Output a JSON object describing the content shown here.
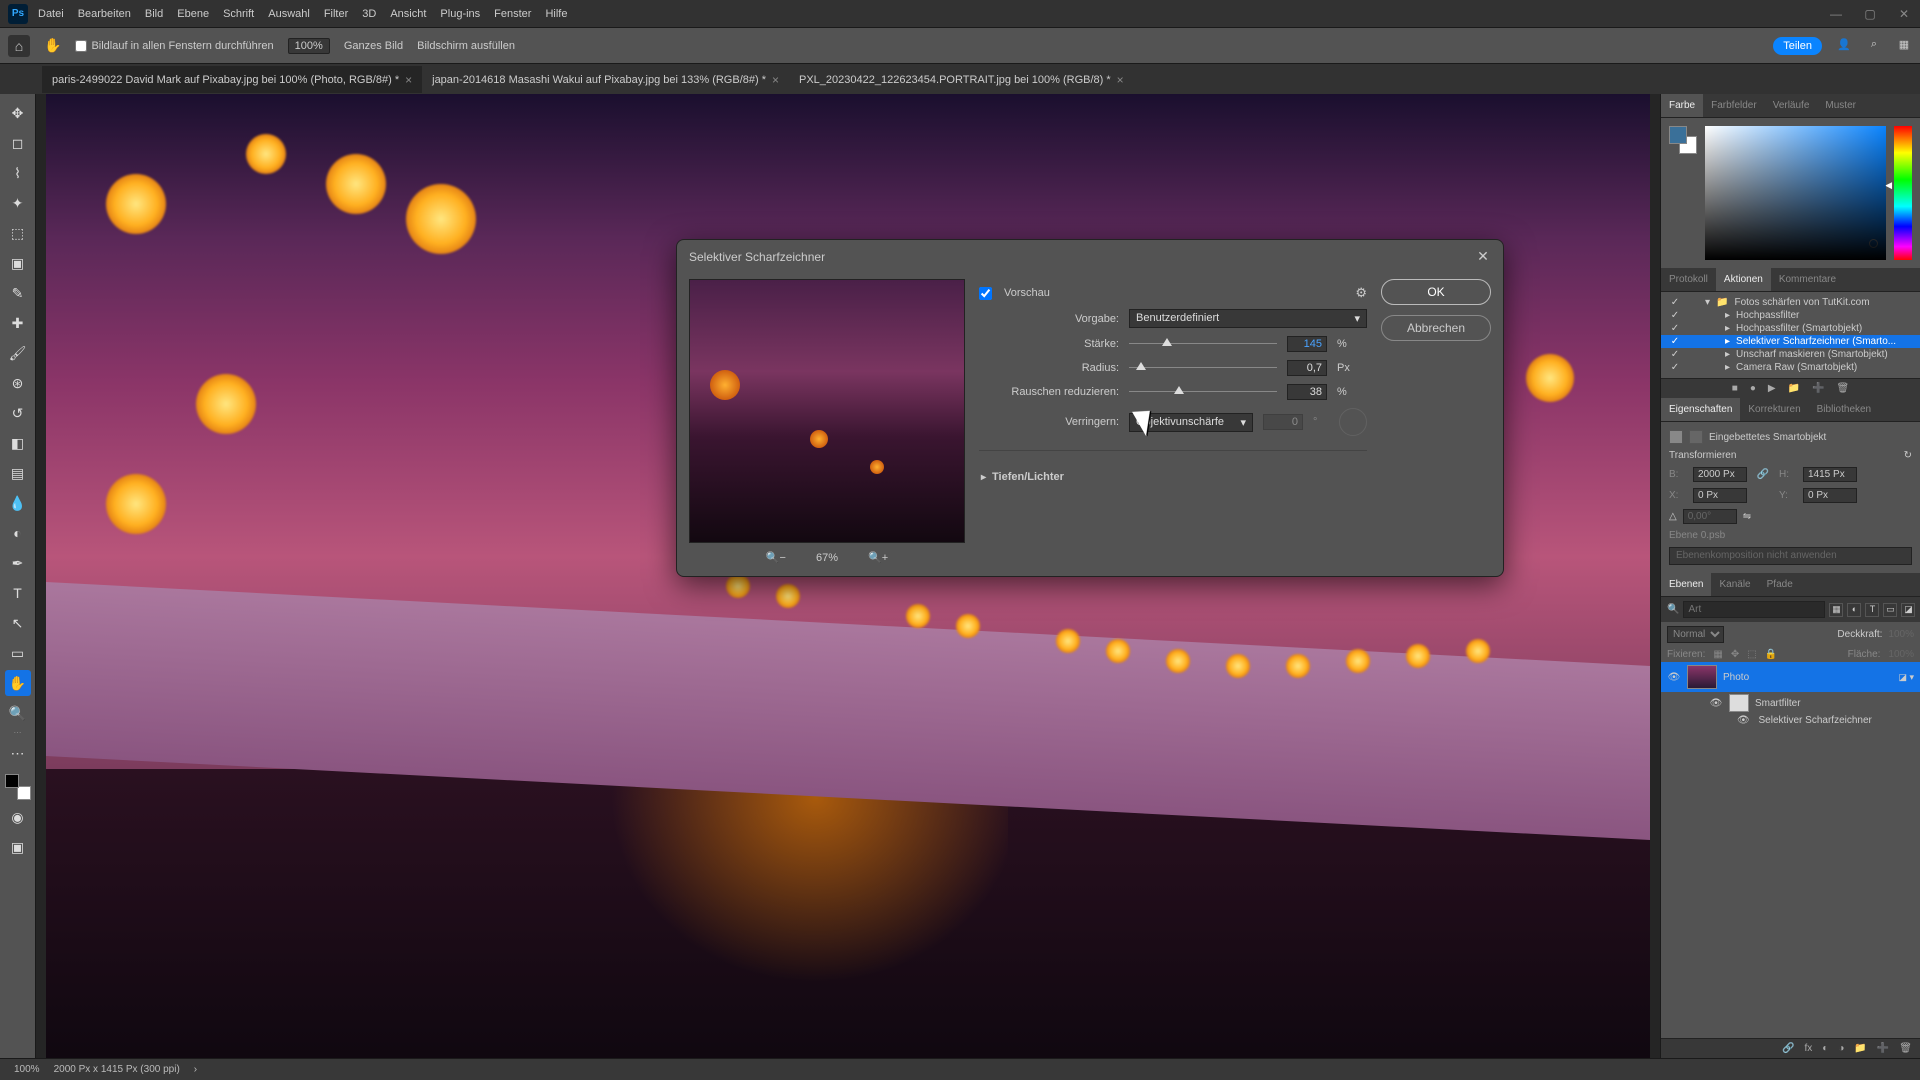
{
  "menu": {
    "items": [
      "Datei",
      "Bearbeiten",
      "Bild",
      "Ebene",
      "Schrift",
      "Auswahl",
      "Filter",
      "3D",
      "Ansicht",
      "Plug-ins",
      "Fenster",
      "Hilfe"
    ]
  },
  "options": {
    "scroll_all": "Bildlauf in allen Fenstern durchführen",
    "zoom_val": "100%",
    "fit": "Ganzes Bild",
    "fill": "Bildschirm ausfüllen",
    "share": "Teilen"
  },
  "tabs": [
    {
      "label": "paris-2499022  David Mark auf Pixabay.jpg bei 100% (Photo, RGB/8#) *",
      "active": true
    },
    {
      "label": "japan-2014618 Masashi Wakui auf Pixabay.jpg bei 133% (RGB/8#) *",
      "active": false
    },
    {
      "label": "PXL_20230422_122623454.PORTRAIT.jpg bei 100% (RGB/8) *",
      "active": false
    }
  ],
  "dialog": {
    "title": "Selektiver Scharfzeichner",
    "preview_label": "Vorschau",
    "preset_label": "Vorgabe:",
    "preset_value": "Benutzerdefiniert",
    "strength_label": "Stärke:",
    "strength_value": "145",
    "strength_unit": "%",
    "radius_label": "Radius:",
    "radius_value": "0,7",
    "radius_unit": "Px",
    "noise_label": "Rauschen reduzieren:",
    "noise_value": "38",
    "noise_unit": "%",
    "remove_label": "Verringern:",
    "remove_value": "Objektivunschärfe",
    "remove_amount": "0",
    "remove_unit": "°",
    "section": "Tiefen/Lichter",
    "zoom": "67%",
    "ok": "OK",
    "cancel": "Abbrechen"
  },
  "right": {
    "color_tabs": [
      "Farbe",
      "Farbfelder",
      "Verläufe",
      "Muster"
    ],
    "action_tabs": [
      "Protokoll",
      "Aktionen",
      "Kommentare"
    ],
    "actions_folder": "Fotos schärfen von TutKit.com",
    "actions": [
      {
        "name": "Hochpassfilter",
        "sel": false
      },
      {
        "name": "Hochpassfilter (Smartobjekt)",
        "sel": false
      },
      {
        "name": "Selektiver Scharfzeichner (Smarto...",
        "sel": true
      },
      {
        "name": "Unscharf maskieren (Smartobjekt)",
        "sel": false
      },
      {
        "name": "Camera Raw (Smartobjekt)",
        "sel": false
      }
    ],
    "props_tabs": [
      "Eigenschaften",
      "Korrekturen",
      "Bibliotheken"
    ],
    "props": {
      "type": "Eingebettetes Smartobjekt",
      "transform_head": "Transformieren",
      "w_lbl": "B:",
      "w": "2000 Px",
      "h_lbl": "H:",
      "h": "1415 Px",
      "x_lbl": "X:",
      "x": "0 Px",
      "y_lbl": "Y:",
      "y": "0 Px",
      "angle": "0,00°",
      "layer_name": "Ebene 0.psb",
      "comp": "Ebenenkomposition nicht anwenden"
    },
    "layer_tabs": [
      "Ebenen",
      "Kanäle",
      "Pfade"
    ],
    "layers": {
      "search_ph": "Art",
      "blend": "Normal",
      "opacity_lbl": "Deckkraft:",
      "opacity": "100%",
      "lock_lbl": "Fixieren:",
      "fill_lbl": "Fläche:",
      "fill": "100%",
      "layer_name": "Photo",
      "smartfilter": "Smartfilter",
      "filter_item": "Selektiver Scharfzeichner"
    }
  },
  "status": {
    "zoom": "100%",
    "dims": "2000 Px x 1415 Px (300 ppi)"
  }
}
